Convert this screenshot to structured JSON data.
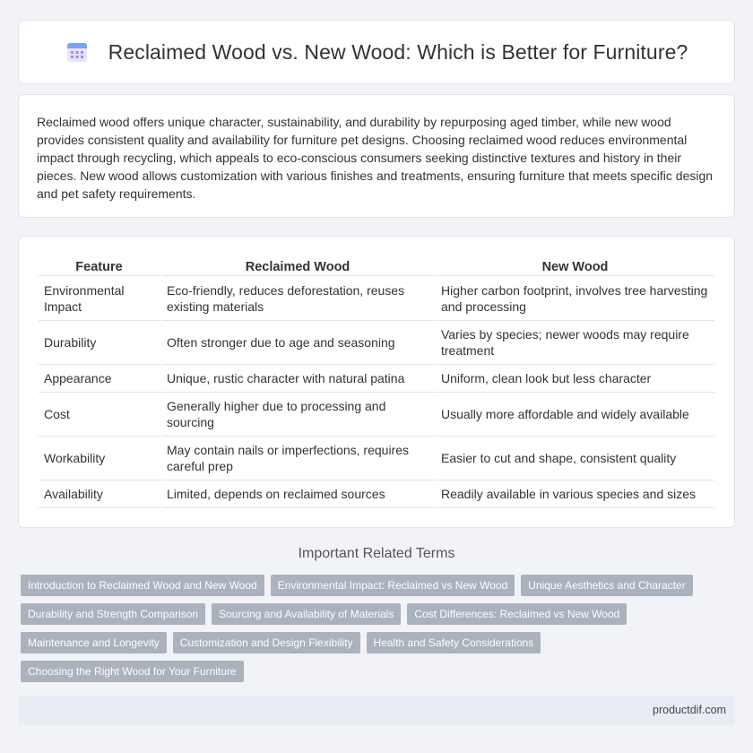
{
  "header": {
    "title": "Reclaimed Wood vs. New Wood: Which is Better for Furniture?",
    "icon": "calendar-icon"
  },
  "intro": {
    "text": "Reclaimed wood offers unique character, sustainability, and durability by repurposing aged timber, while new wood provides consistent quality and availability for furniture pet designs. Choosing reclaimed wood reduces environmental impact through recycling, which appeals to eco-conscious consumers seeking distinctive textures and history in their pieces. New wood allows customization with various finishes and treatments, ensuring furniture that meets specific design and pet safety requirements."
  },
  "table": {
    "headers": [
      "Feature",
      "Reclaimed Wood",
      "New Wood"
    ],
    "rows": [
      [
        "Environmental Impact",
        "Eco-friendly, reduces deforestation, reuses existing materials",
        "Higher carbon footprint, involves tree harvesting and processing"
      ],
      [
        "Durability",
        "Often stronger due to age and seasoning",
        "Varies by species; newer woods may require treatment"
      ],
      [
        "Appearance",
        "Unique, rustic character with natural patina",
        "Uniform, clean look but less character"
      ],
      [
        "Cost",
        "Generally higher due to processing and sourcing",
        "Usually more affordable and widely available"
      ],
      [
        "Workability",
        "May contain nails or imperfections, requires careful prep",
        "Easier to cut and shape, consistent quality"
      ],
      [
        "Availability",
        "Limited, depends on reclaimed sources",
        "Readily available in various species and sizes"
      ]
    ]
  },
  "related": {
    "title": "Important Related Terms",
    "tags": [
      "Introduction to Reclaimed Wood and New Wood",
      "Environmental Impact: Reclaimed vs New Wood",
      "Unique Aesthetics and Character",
      "Durability and Strength Comparison",
      "Sourcing and Availability of Materials",
      "Cost Differences: Reclaimed vs New Wood",
      "Maintenance and Longevity",
      "Customization and Design Flexibility",
      "Health and Safety Considerations",
      "Choosing the Right Wood for Your Furniture"
    ]
  },
  "footer": {
    "site": "productdif.com"
  },
  "colors": {
    "background": "#f1f3f7",
    "tag": "#aab2be",
    "icon_blue": "#5b8def",
    "icon_purple": "#9b7be0"
  }
}
